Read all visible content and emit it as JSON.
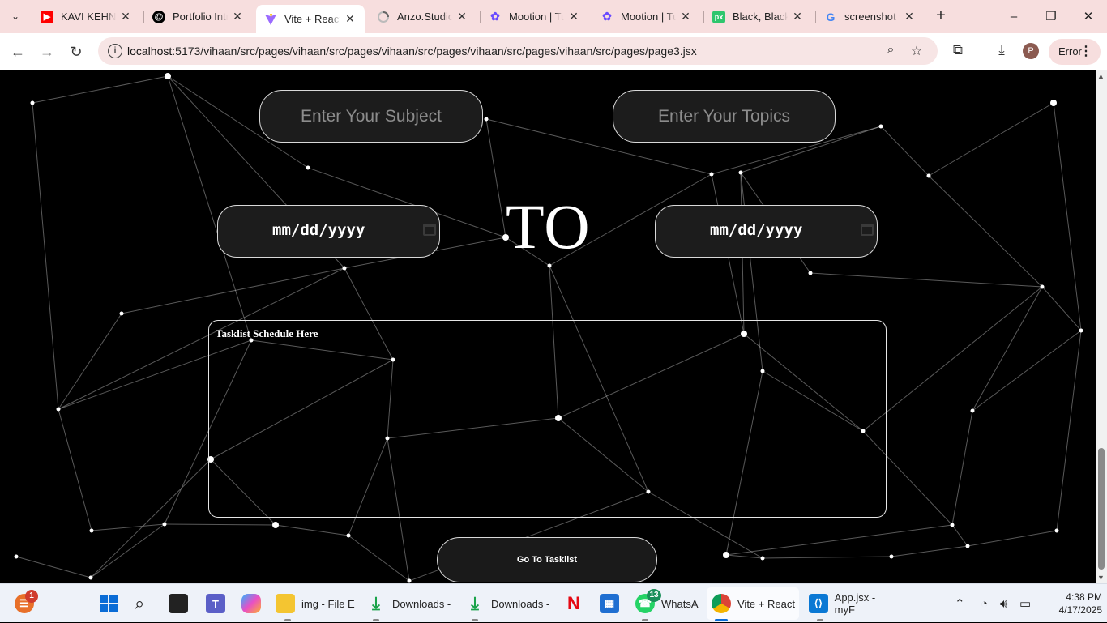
{
  "browser": {
    "tabs": [
      {
        "title": "KAVI KEHNA",
        "icon": "youtube-icon",
        "color": "#ff0000"
      },
      {
        "title": "Portfolio Intr",
        "icon": "chatgpt-icon",
        "color": "#000000"
      },
      {
        "title": "Vite + React",
        "icon": "vite-icon",
        "color": "#8a63ff",
        "active": true
      },
      {
        "title": "Anzo.Studio",
        "icon": "loading-icon",
        "color": "#999999"
      },
      {
        "title": "Mootion | Tu",
        "icon": "mootion-icon",
        "color": "#6a4bff"
      },
      {
        "title": "Mootion | Tu",
        "icon": "mootion-icon",
        "color": "#6a4bff"
      },
      {
        "title": "Black, Black",
        "icon": "pixabay-icon",
        "color": "#2ec66d"
      },
      {
        "title": "screenshot w",
        "icon": "google-icon",
        "color": "#4285f4"
      }
    ],
    "url_host": "localhost",
    "url_path": ":5173/vihaan/src/pages/vihaan/src/pages/vihaan/src/pages/vihaan/src/pages/vihaan/src/pages/page3.jsx",
    "error_label": "Error",
    "profile_initial": "P"
  },
  "page": {
    "subject_placeholder": "Enter Your Subject",
    "topics_placeholder": "Enter Your Topics",
    "date_from": "mm/dd/yyyy",
    "date_to": "mm/dd/yyyy",
    "to_label": "TO",
    "tasklist_placeholder": "Tasklist Schedule Here",
    "go_button": "Go To Tasklist"
  },
  "taskbar": {
    "notification_count": "1",
    "items": [
      {
        "label": "img - File E",
        "icon": "folder-icon"
      },
      {
        "label": "Downloads -",
        "icon": "download-icon"
      },
      {
        "label": "Downloads -",
        "icon": "download-icon"
      },
      {
        "label": "WhatsA",
        "icon": "whatsapp-icon",
        "badge": "13"
      },
      {
        "label": "Vite + React",
        "icon": "chrome-icon"
      },
      {
        "label": "App.jsx - myF",
        "icon": "vscode-icon"
      }
    ],
    "time": "4:38 PM",
    "date": "4/17/2025"
  }
}
